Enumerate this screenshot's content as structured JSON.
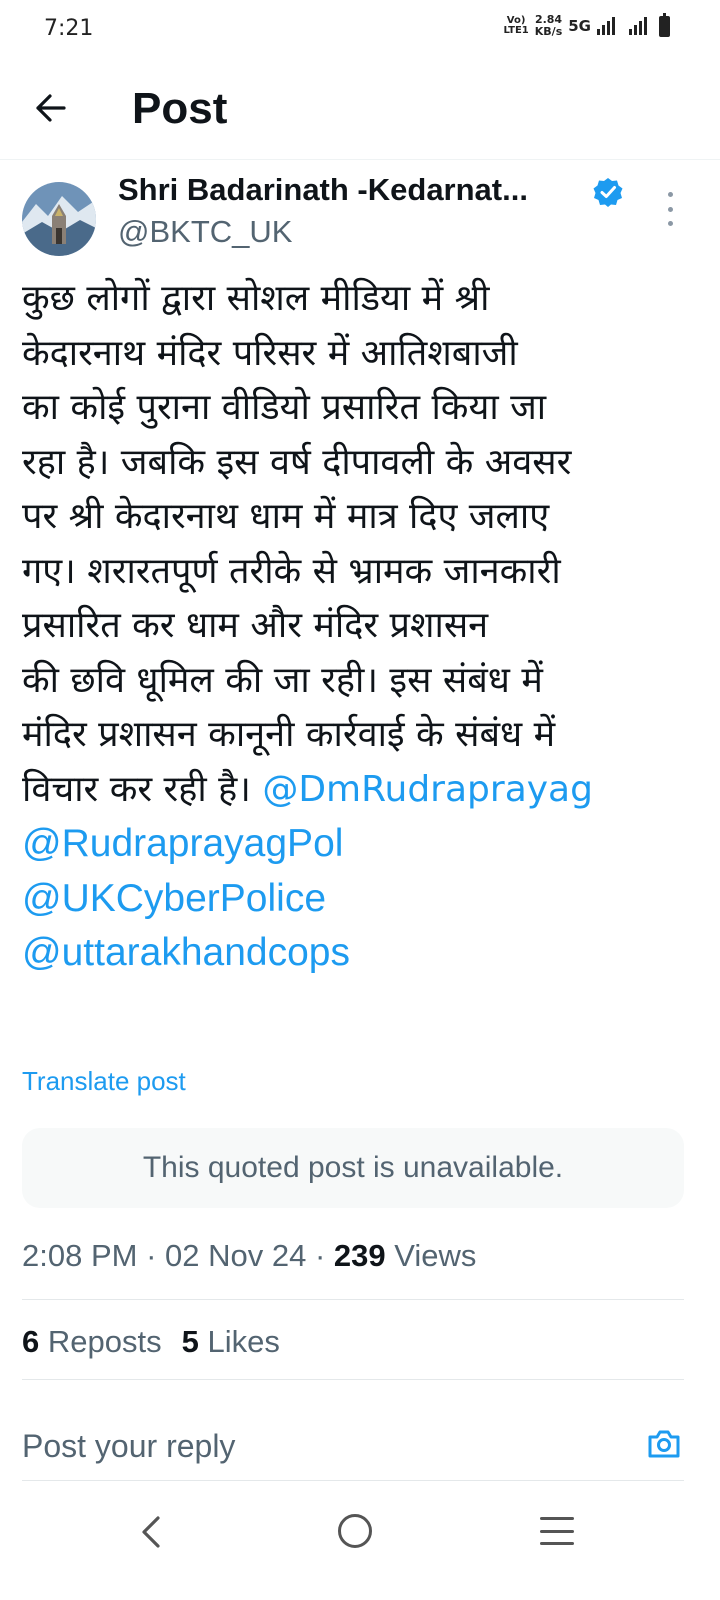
{
  "status_bar": {
    "time": "7:21",
    "volte": "Vo)\nLTE1",
    "speed_value": "2.84",
    "speed_unit": "KB/s",
    "network": "5G",
    "icons": [
      "volte-icon",
      "signal-icon",
      "battery-icon"
    ]
  },
  "header": {
    "back_icon": "arrow-left-icon",
    "title": "Post"
  },
  "author": {
    "name": "Shri Badarinath -Kedarnat...",
    "handle": "@BKTC_UK",
    "verified_icon": "verified-badge-icon",
    "more_icon": "more-vertical-icon"
  },
  "post": {
    "lines": [
      "कुछ लोगों द्वारा सोशल मीडिया में श्री",
      "केदारनाथ मंदिर परिसर में आतिशबाजी",
      "का कोई पुराना वीडियो प्रसारित किया जा",
      "रहा है। जबकि इस वर्ष दीपावली के अवसर",
      "पर श्री केदारनाथ धाम में मात्र दिए जलाए",
      "गए। शरारतपूर्ण तरीके से भ्रामक जानकारी",
      "प्रसारित कर  धाम और मंदिर प्रशासन",
      "की छवि धूमिल की जा रही। इस संबंध में",
      "मंदिर प्रशासन कानूनी कार्रवाई के संबंध में"
    ],
    "last_line_text": "विचार कर रही है। ",
    "mentions": [
      "@DmRudraprayag",
      "@RudraprayagPol",
      "@UKCyberPolice",
      "@uttarakhandcops"
    ],
    "mention_color": "#1d9bf0"
  },
  "translate_label": "Translate post",
  "quoted_post": {
    "text": "This quoted post is unavailable."
  },
  "meta": {
    "time": "2:08 PM",
    "separator": " · ",
    "date": "02 Nov 24",
    "views_count": "239",
    "views_label": " Views"
  },
  "stats": {
    "reposts_count": "6",
    "reposts_label": " Reposts",
    "likes_count": "5",
    "likes_label": " Likes"
  },
  "reply": {
    "placeholder": "Post your reply",
    "camera_icon": "camera-icon"
  },
  "nav_bar": {
    "icons": [
      "nav-back-icon",
      "nav-home-icon",
      "nav-recents-icon"
    ]
  }
}
